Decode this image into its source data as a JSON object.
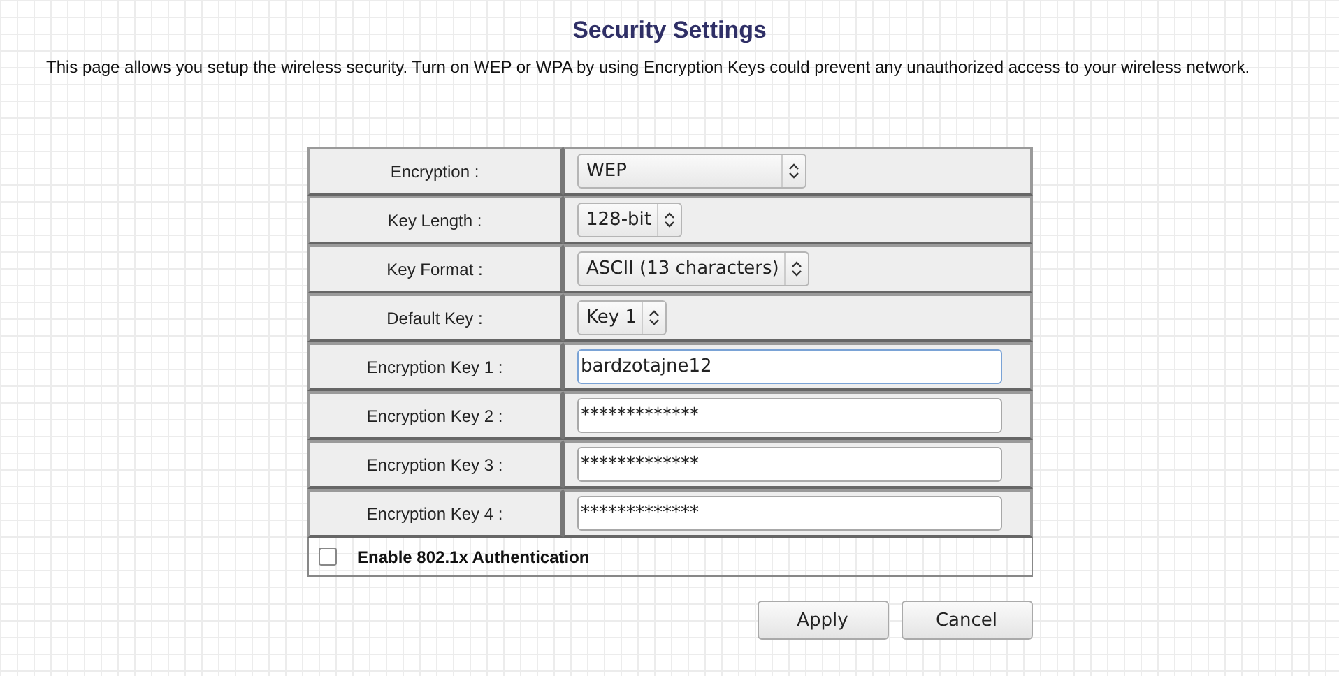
{
  "title": "Security Settings",
  "intro": "This page allows you setup the wireless security. Turn on WEP or WPA by using Encryption Keys could prevent any unauthorized access to your wireless network.",
  "rows": [
    {
      "label": "Encryption :",
      "kind": "select",
      "value": "WEP"
    },
    {
      "label": "Key Length :",
      "kind": "select",
      "value": "128-bit"
    },
    {
      "label": "Key Format :",
      "kind": "select",
      "value": "ASCII (13 characters)"
    },
    {
      "label": "Default Key :",
      "kind": "select",
      "value": "Key 1"
    },
    {
      "label": "Encryption Key 1 :",
      "kind": "input",
      "value": "bardzotajne12",
      "focused": true
    },
    {
      "label": "Encryption Key 2 :",
      "kind": "input",
      "value": "*************",
      "focused": false
    },
    {
      "label": "Encryption Key 3 :",
      "kind": "input",
      "value": "*************",
      "focused": false
    },
    {
      "label": "Encryption Key 4 :",
      "kind": "input",
      "value": "*************",
      "focused": false
    }
  ],
  "auth": {
    "label": "Enable 802.1x Authentication",
    "checked": false
  },
  "buttons": [
    "Apply",
    "Cancel"
  ]
}
